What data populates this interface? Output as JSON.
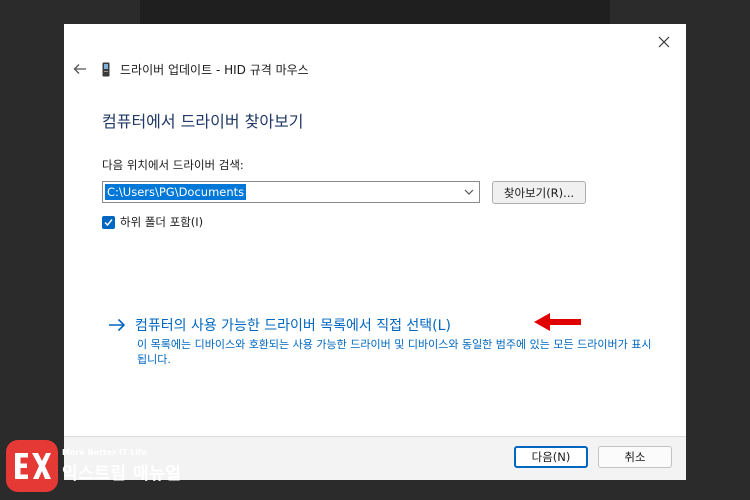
{
  "window": {
    "title": "드라이버 업데이트 - HID 규격 마우스",
    "heading": "컴퓨터에서 드라이버 찾아보기"
  },
  "search": {
    "label": "다음 위치에서 드라이버 검색:",
    "path_value": "C:\\Users\\PG\\Documents",
    "browse_label": "찾아보기(R)...",
    "include_subfolders_label": "하위 폴더 포함(I)",
    "include_subfolders_checked": true
  },
  "pick_from_list": {
    "link_text": "컴퓨터의 사용 가능한 드라이버 목록에서 직접 선택(L)",
    "description": "이 목록에는 디바이스와 호환되는 사용 가능한 드라이버 및 디바이스와 동일한 범주에 있는 모든 드라이버가 표시됩니다."
  },
  "footer": {
    "next_label": "다음(N)",
    "cancel_label": "취소"
  },
  "watermark": {
    "tagline": "More Better IT Life",
    "name": "익스트림 매뉴얼"
  },
  "icons": {
    "close": "close-icon",
    "back": "back-arrow-icon",
    "device": "device-icon",
    "dropdown": "chevron-down-icon",
    "check": "check-icon",
    "link_arrow": "right-arrow-icon",
    "annotation": "red-arrow-icon"
  },
  "colors": {
    "accent": "#0067c0",
    "selection": "#0078d7",
    "heading": "#1f3864",
    "annotation": "#e00000",
    "logo": "#e53935"
  }
}
